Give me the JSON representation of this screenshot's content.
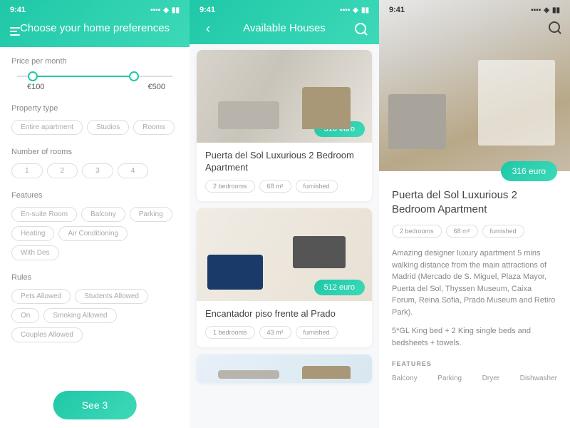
{
  "status": {
    "time": "9:41"
  },
  "screen1": {
    "title": "Choose your home preferences",
    "price_label": "Price per month",
    "price_min": "€100",
    "price_max": "€500",
    "ptype_label": "Property type",
    "ptype": [
      "Entire apartment",
      "Studios",
      "Rooms"
    ],
    "rooms_label": "Number of rooms",
    "rooms": [
      "1",
      "2",
      "3",
      "4"
    ],
    "features_label": "Features",
    "features": [
      "En-suite Room",
      "Balcony",
      "Parking",
      "Heating",
      "Air Conditioning",
      "With Des"
    ],
    "rules_label": "Rules",
    "rules": [
      "Pets Allowed",
      "Students Allowed",
      "On",
      "Smoking Allowed",
      "Couples Allowed"
    ],
    "cta": "See 3"
  },
  "screen2": {
    "title": "Available Houses",
    "cards": [
      {
        "price": "316 euro",
        "title": "Puerta del Sol Luxurious 2 Bedroom Apartment",
        "tags": [
          "2 bedrooms",
          "68 m²",
          "furnished"
        ]
      },
      {
        "price": "512 euro",
        "title": "Encantador piso frente al Prado",
        "tags": [
          "1 bedrooms",
          "43 m²",
          "furnished"
        ]
      }
    ]
  },
  "screen3": {
    "price": "316 euro",
    "title": "Puerta del Sol Luxurious 2 Bedroom Apartment",
    "tags": [
      "2 bedrooms",
      "68 m²",
      "furnished"
    ],
    "desc1": "Amazing designer luxury apartment 5 mins walking distance from the main attractions of Madrid (Mercado de S. Miguel, Plaza Mayor, Puerta del Sol, Thyssen Museum, Caixa Forum, Reina Sofia, Prado Museum and Retiro Park).",
    "desc2": "5*GL King bed + 2 King single beds and bedsheets + towels.",
    "feat_label": "FEATURES",
    "features": [
      "Balcony",
      "Parking",
      "Dryer",
      "Dishwasher"
    ]
  }
}
